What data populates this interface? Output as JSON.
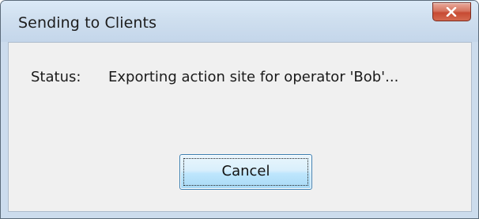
{
  "window": {
    "title": "Sending to Clients"
  },
  "status": {
    "label": "Status:",
    "value": "Exporting action site for operator 'Bob'..."
  },
  "buttons": {
    "cancel_label": "Cancel"
  },
  "icons": {
    "close": "close-icon"
  },
  "colors": {
    "frame": "#ccdced",
    "close_button": "#c74a33",
    "client_background": "#f0f0f0",
    "button_accent": "#3c7fb1"
  }
}
